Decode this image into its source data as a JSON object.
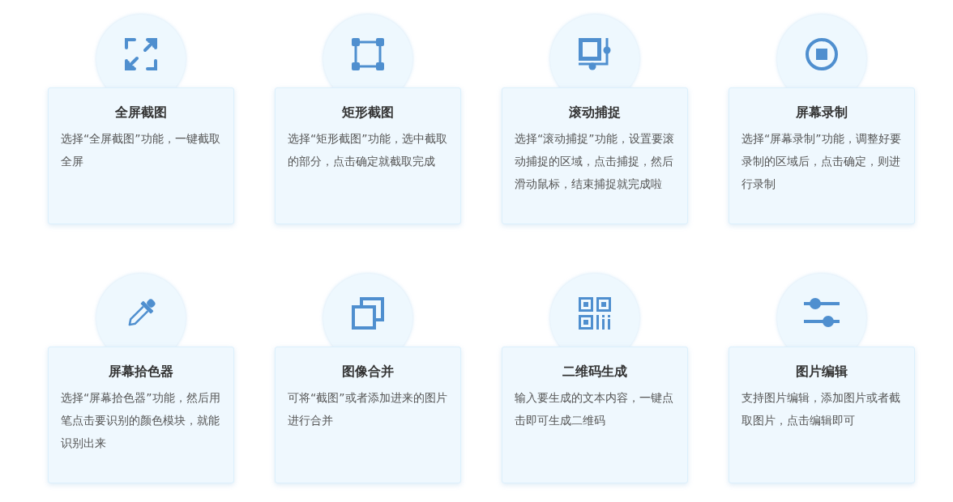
{
  "features": [
    {
      "kind": "fullscreen",
      "title": "全屏截图",
      "description": "选择“全屏截图”功能，一键截取全屏"
    },
    {
      "kind": "rectangle",
      "title": "矩形截图",
      "description": "选择“矩形截图”功能，选中截取的部分，点击确定就截取完成"
    },
    {
      "kind": "scroll",
      "title": "滚动捕捉",
      "description": "选择“滚动捕捉”功能，设置要滚动捕捉的区域，点击捕捉，然后滑动鼠标，结束捕捉就完成啦"
    },
    {
      "kind": "record",
      "title": "屏幕录制",
      "description": "选择“屏幕录制”功能，调整好要录制的区域后，点击确定，则进行录制"
    },
    {
      "kind": "picker",
      "title": "屏幕拾色器",
      "description": "选择“屏幕拾色器”功能，然后用笔点击要识别的颜色模块，就能识别出来"
    },
    {
      "kind": "merge",
      "title": "图像合并",
      "description": "可将“截图”或者添加进来的图片进行合并"
    },
    {
      "kind": "qrcode",
      "title": "二维码生成",
      "description": "输入要生成的文本内容，一键点击即可生成二维码"
    },
    {
      "kind": "edit",
      "title": "图片编辑",
      "description": "支持图片编辑，添加图片或者截取图片，点击编辑即可"
    }
  ]
}
